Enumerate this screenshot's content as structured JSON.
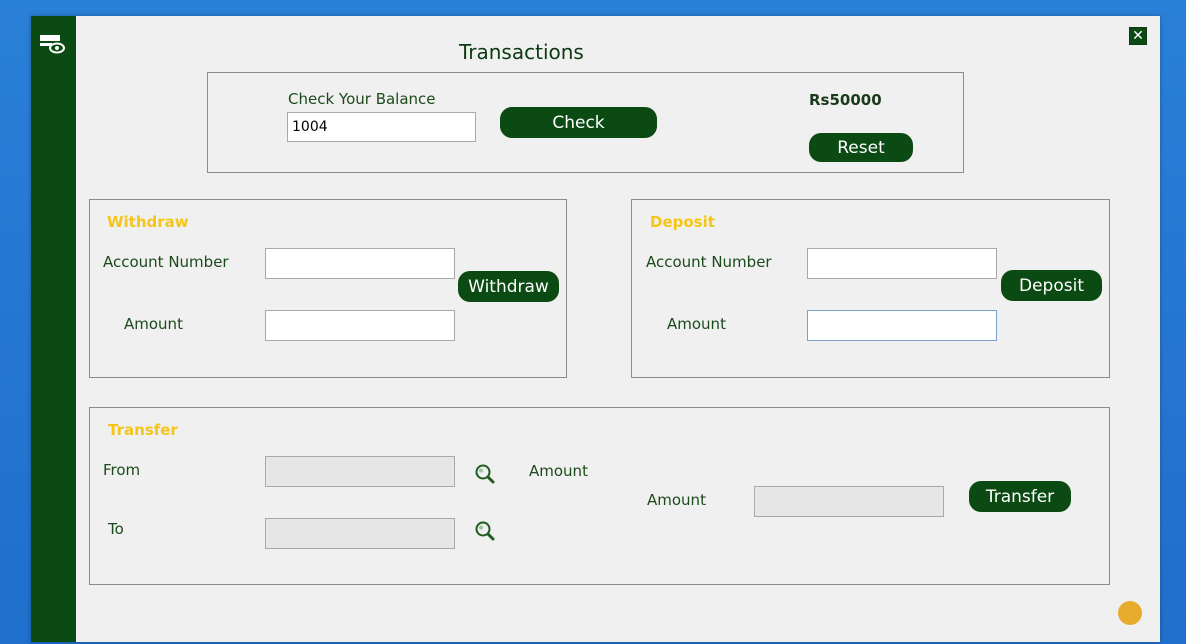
{
  "window": {
    "title": "Transactions",
    "close_label": "✕"
  },
  "balance": {
    "label": "Check Your Balance",
    "account_value": "1004",
    "check_label": "Check",
    "amount": "Rs50000",
    "reset_label": "Reset"
  },
  "withdraw": {
    "title": "Withdraw",
    "account_label": "Account Number",
    "amount_label": "Amount",
    "account_value": "",
    "amount_value": "",
    "button_label": "Withdraw"
  },
  "deposit": {
    "title": "Deposit",
    "account_label": "Account Number",
    "amount_label": "Amount",
    "account_value": "",
    "amount_value": "",
    "button_label": "Deposit"
  },
  "transfer": {
    "title": "Transfer",
    "from_label": "From",
    "to_label": "To",
    "amount_label_top": "Amount",
    "amount_label": "Amount",
    "from_value": "",
    "to_value": "",
    "amount_value": "",
    "button_label": "Transfer"
  },
  "colors": {
    "accent": "#0b4a12",
    "section_title": "#f5c518",
    "background": "#f0f0f0"
  }
}
